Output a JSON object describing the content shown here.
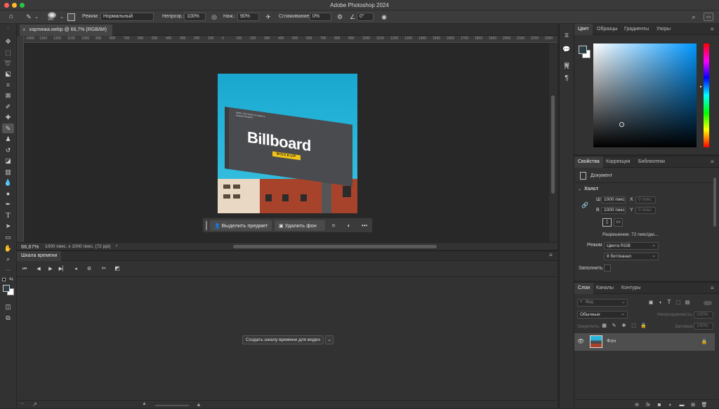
{
  "app_title": "Adobe Photoshop 2024",
  "options": {
    "brush_size": "940",
    "mode_label": "Режим:",
    "mode_value": "Нормальный",
    "opacity_label": "Непрозр.:",
    "opacity_value": "100%",
    "pressure_label": "Наж.:",
    "pressure_value": "90%",
    "smoothing_label": "Сглаживание:",
    "smoothing_value": "0%",
    "angle_value": "0°"
  },
  "document": {
    "tab_title": "картинка.webp @ 66,7% (RGB/8#)",
    "zoom": "66,67%",
    "doc_info": "1000 пикс. x 1000 пикс. (72 ppi)"
  },
  "ruler_ticks": [
    "-1400",
    "1300",
    "1200",
    "1100",
    "1000",
    "900",
    "800",
    "700",
    "600",
    "500",
    "400",
    "300",
    "200",
    "100",
    "0",
    "100",
    "200",
    "300",
    "400",
    "500",
    "600",
    "700",
    "800",
    "900",
    "1000",
    "1100",
    "1200",
    "1300",
    "1400",
    "1500",
    "1600",
    "1700",
    "1800",
    "1900",
    "2000",
    "2100",
    "2200",
    "2300"
  ],
  "artwork": {
    "billboard_title": "Billboard",
    "billboard_subtitle": "MOCKUP",
    "small_text": "WHAT YOU NEED TO HAVE A BIGGER ADVERT"
  },
  "contextual_bar": {
    "select_subject": "Выделить предмет",
    "remove_bg": "Удалить фон"
  },
  "timeline": {
    "panel_title": "Шкала времени",
    "create_button": "Создать шкалу времени для видео"
  },
  "color_panel": {
    "tabs": [
      "Цвет",
      "Образцы",
      "Градиенты",
      "Узоры"
    ],
    "foreground": "#2e3e46",
    "background": "#ffffff"
  },
  "properties_panel": {
    "tabs": [
      "Свойства",
      "Коррекция",
      "Библиотеки"
    ],
    "doc_label": "Документ",
    "canvas_label": "Холст",
    "w_label": "Ш",
    "w_value": "1000 пикс",
    "h_label": "В",
    "h_value": "1000 пикс",
    "x_label": "X",
    "x_value": "0 пикс",
    "y_label": "Y",
    "y_value": "0 пикс",
    "resolution": "Разрешение: 72 пикс/дю...",
    "mode_label": "Режим",
    "mode_value": "Цвета RGB",
    "depth_value": "8 бит/канал",
    "fill_label": "Заполнить"
  },
  "layers_panel": {
    "tabs": [
      "Слои",
      "Каналы",
      "Контуры"
    ],
    "search_placeholder": "Вид",
    "blend_mode": "Обычные",
    "opacity_label": "Непрозрачность:",
    "opacity_value": "100%",
    "lock_label": "Закрепить:",
    "fill_label": "Заливка:",
    "fill_value": "100%",
    "layer_name": "Фон"
  }
}
